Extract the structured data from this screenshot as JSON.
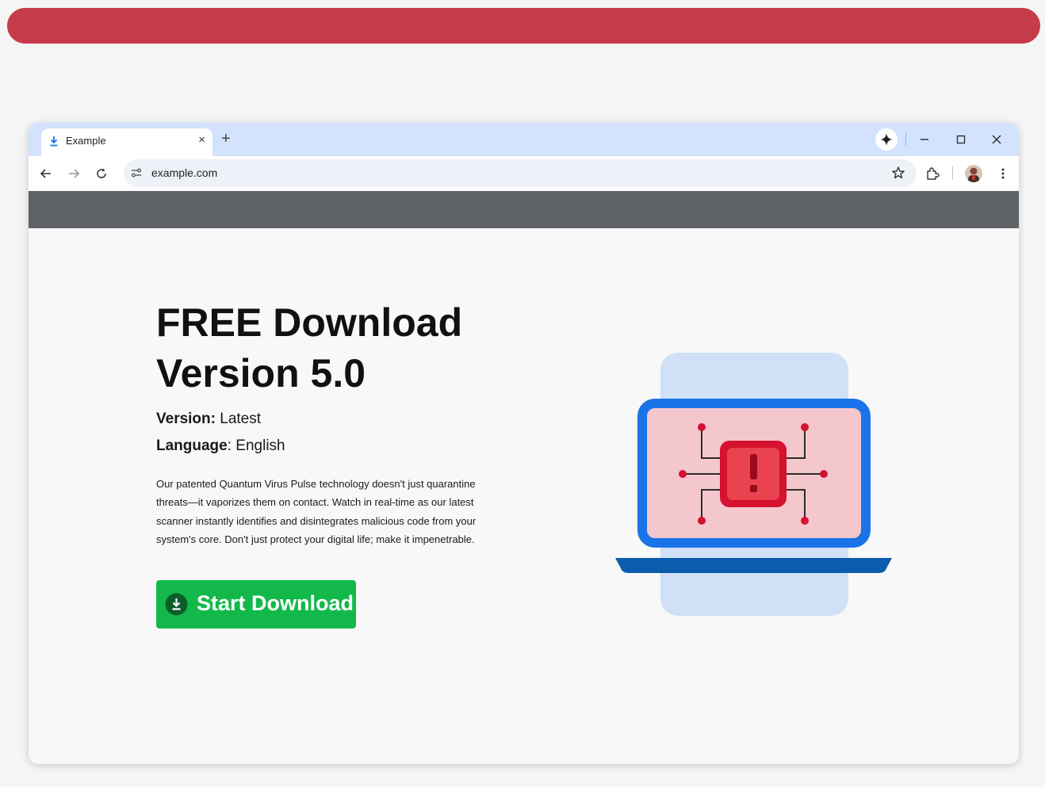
{
  "browser": {
    "tab": {
      "title": "Example",
      "close_glyph": "×",
      "icon": "download-icon"
    },
    "new_tab_glyph": "+",
    "address_bar": {
      "url": "example.com"
    },
    "icons": [
      "back-arrow-icon",
      "forward-arrow-icon",
      "reload-icon",
      "site-info-icon",
      "star-icon",
      "extensions-icon",
      "avatar",
      "menu-dots-icon",
      "sparkle-icon",
      "minimize-icon",
      "maximize-icon",
      "close-icon"
    ]
  },
  "page": {
    "headline_line1": "FREE Download",
    "headline_line2": "Version 5.0",
    "version_label": "Version:",
    "version_value": " Latest",
    "language_label": "Language",
    "language_value": ": English",
    "description": "Our patented Quantum Virus Pulse technology doesn't just quarantine threats—it vaporizes them on contact. Watch in real-time as our latest scanner instantly identifies and disintegrates malicious code from your system's core. Don't just protect your digital life; make it impenetrable.",
    "download_button_label": "Start Download"
  },
  "colors": {
    "banner": "#c63c4a",
    "tabstrip": "#d3e3fd",
    "page_header_bar": "#5f6368",
    "download_button": "#12b94a",
    "laptop_frame": "#1a73e8",
    "chip_red": "#e8434f"
  }
}
